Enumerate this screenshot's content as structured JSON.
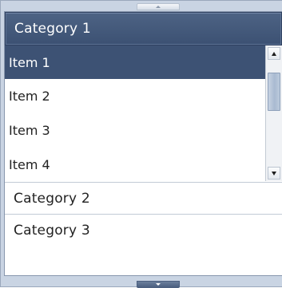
{
  "accordion": {
    "categories": [
      {
        "label": "Category 1",
        "expanded": true,
        "items": [
          "Item 1",
          "Item 2",
          "Item 3",
          "Item 4"
        ],
        "selected_item": "Item 1"
      },
      {
        "label": "Category 2",
        "expanded": false
      },
      {
        "label": "Category 3",
        "expanded": false
      }
    ],
    "scroll_up_icon": "triangle-up-icon",
    "scroll_down_icon": "triangle-down-icon"
  },
  "list_scrollbar": {
    "thumb_start": 0.12,
    "thumb_fraction": 0.36
  },
  "colors": {
    "active_header": "#3f5476",
    "selected_item": "#3d5274",
    "frame": "#c9d4e3"
  }
}
